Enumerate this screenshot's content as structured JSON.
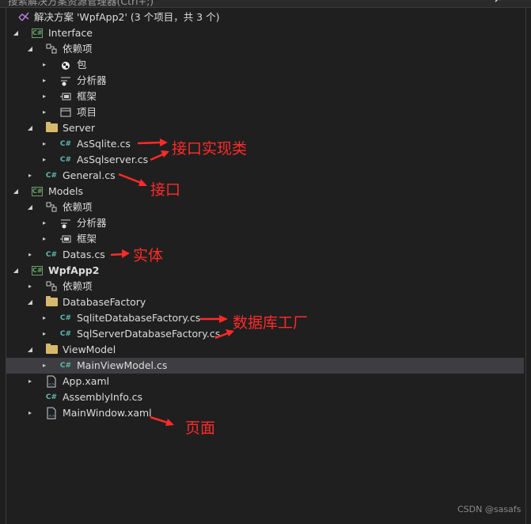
{
  "search": {
    "placeholder": "搜索解决方案资源管理器(Ctrl+;)"
  },
  "tree": {
    "solution": "解决方案 'WpfApp2' (3 个项目，共 3 个)",
    "interface_project": "Interface",
    "interface_deps": "依赖项",
    "interface_pkg": "包",
    "interface_analyzers": "分析器",
    "interface_frameworks": "框架",
    "interface_projects": "项目",
    "server_folder": "Server",
    "assqlite": "AsSqlite.cs",
    "assqlserver": "AsSqlserver.cs",
    "general": "General.cs",
    "models_project": "Models",
    "models_deps": "依赖项",
    "models_analyzers": "分析器",
    "models_frameworks": "框架",
    "datas": "Datas.cs",
    "wpf_project": "WpfApp2",
    "wpf_deps": "依赖项",
    "dbfactory_folder": "DatabaseFactory",
    "sqlite_factory": "SqliteDatabaseFactory.cs",
    "sqlserver_factory": "SqlServerDatabaseFactory.cs",
    "viewmodel_folder": "ViewModel",
    "mainviewmodel": "MainViewModel.cs",
    "app_xaml": "App.xaml",
    "assemblyinfo": "AssemblyInfo.cs",
    "mainwindow": "MainWindow.xaml"
  },
  "annotations": {
    "impl": "接口实现类",
    "iface": "接口",
    "entity": "实体",
    "factory": "数据库工厂",
    "page": "页面"
  },
  "icons": {
    "csharp": "C#",
    "project": "C#",
    "expand": "▸",
    "collapse": "◢"
  },
  "colors": {
    "annotation": "#ff2a2a",
    "selected_row": "#3e3e42",
    "csharp": "#5db9ae",
    "folder": "#d7b96b"
  },
  "watermark": "CSDN @sasafs"
}
